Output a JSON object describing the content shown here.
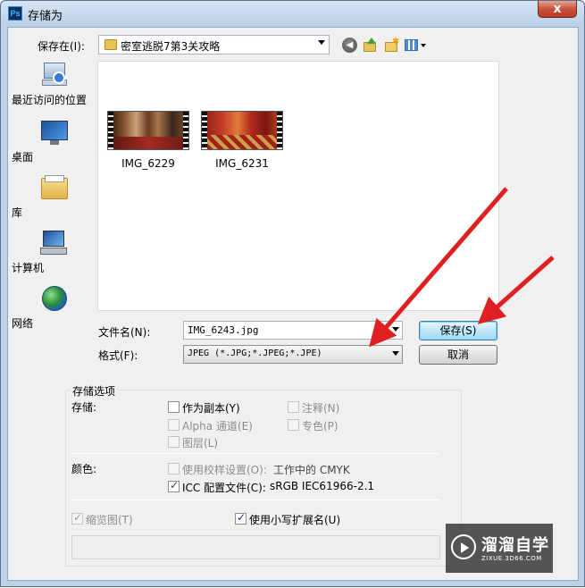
{
  "window": {
    "title": "存储为",
    "app_icon": "Ps",
    "close_label": "x"
  },
  "toolbar": {
    "save_in_label": "保存在(I):",
    "save_in_value": "密室逃脱7第3关攻略",
    "icons": [
      "back-icon",
      "up-folder-icon",
      "new-folder-icon",
      "view-menu-icon"
    ]
  },
  "places": [
    {
      "label": "最近访问的位置",
      "icon": "recent-places-icon"
    },
    {
      "label": "桌面",
      "icon": "desktop-icon"
    },
    {
      "label": "库",
      "icon": "libraries-icon"
    },
    {
      "label": "计算机",
      "icon": "computer-icon"
    },
    {
      "label": "网络",
      "icon": "network-icon"
    }
  ],
  "files": [
    {
      "name": "IMG_6229"
    },
    {
      "name": "IMG_6231"
    }
  ],
  "form": {
    "filename_label": "文件名(N):",
    "filename_value": "IMG_6243.jpg",
    "format_label": "格式(F):",
    "format_value": "JPEG (*.JPG;*.JPEG;*.JPE)",
    "save_button": "保存(S)",
    "cancel_button": "取消"
  },
  "options": {
    "group_title": "存储选项",
    "storage_label": "存储:",
    "as_copy": {
      "label": "作为副本(Y)",
      "checked": false
    },
    "notes": {
      "label": "注释(N)",
      "checked": false
    },
    "alpha": {
      "label": "Alpha 通道(E)",
      "checked": false
    },
    "spot": {
      "label": "专色(P)",
      "checked": false
    },
    "layers": {
      "label": "图层(L)",
      "checked": false
    },
    "color_label": "颜色:",
    "proof": {
      "label": "使用校样设置(O):",
      "checked": false,
      "value": "工作中的 CMYK"
    },
    "icc": {
      "label": "ICC 配置文件(C):",
      "checked": true,
      "value": "sRGB IEC61966-2.1"
    },
    "thumbnail": {
      "label": "缩览图(T)",
      "checked": true
    },
    "lowercase_ext": {
      "label": "使用小写扩展名(U)",
      "checked": true
    }
  },
  "watermark": {
    "name": "溜溜自学",
    "url": "ZIXUE.3D66.COM"
  },
  "colors": {
    "title_bar": "#bcd1e8",
    "annotation_arrow": "#e02020",
    "dialog_bg": "#f0f0f0"
  }
}
